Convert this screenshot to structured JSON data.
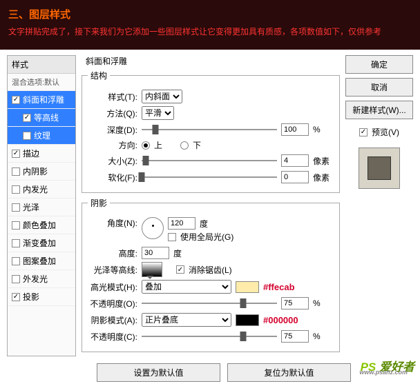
{
  "banner": {
    "title": "三、图层样式",
    "sub": "文字拼贴完成了，接下来我们为它添加一些图层样式让它变得更加具有质感，各项数值如下，仅供参考"
  },
  "sidebar": {
    "header": "样式",
    "bopts": "混合选项:默认",
    "items": [
      {
        "label": "斜面和浮雕",
        "checked": true,
        "selected": true
      },
      {
        "label": "等高线",
        "checked": true,
        "selected": true,
        "indent": true
      },
      {
        "label": "纹理",
        "checked": false,
        "selected": true,
        "indent": true
      },
      {
        "label": "描边",
        "checked": true
      },
      {
        "label": "内阴影",
        "checked": false
      },
      {
        "label": "内发光",
        "checked": false
      },
      {
        "label": "光泽",
        "checked": false
      },
      {
        "label": "颜色叠加",
        "checked": false
      },
      {
        "label": "渐变叠加",
        "checked": false
      },
      {
        "label": "图案叠加",
        "checked": false
      },
      {
        "label": "外发光",
        "checked": false
      },
      {
        "label": "投影",
        "checked": true
      }
    ]
  },
  "panel": {
    "title": "斜面和浮雕",
    "struct": {
      "legend": "结构",
      "style_lbl": "样式(T):",
      "style_val": "内斜面",
      "tech_lbl": "方法(Q):",
      "tech_val": "平滑",
      "depth_lbl": "深度(D):",
      "depth_val": "100",
      "depth_unit": "%",
      "dir_lbl": "方向:",
      "dir_up": "上",
      "dir_down": "下",
      "size_lbl": "大小(Z):",
      "size_val": "4",
      "size_unit": "像素",
      "soft_lbl": "软化(F):",
      "soft_val": "0",
      "soft_unit": "像素"
    },
    "shading": {
      "legend": "阴影",
      "angle_lbl": "角度(N):",
      "angle_val": "120",
      "angle_unit": "度",
      "global_lbl": "使用全局光(G)",
      "alt_lbl": "高度:",
      "alt_val": "30",
      "alt_unit": "度",
      "gloss_lbl": "光泽等高线:",
      "aa_lbl": "消除锯齿(L)",
      "hmode_lbl": "高光模式(H):",
      "hmode_val": "叠加",
      "hhex": "#ffecab",
      "hop_lbl": "不透明度(O):",
      "hop_val": "75",
      "hop_unit": "%",
      "smode_lbl": "阴影模式(A):",
      "smode_val": "正片叠底",
      "shex": "#000000",
      "sop_lbl": "不透明度(C):",
      "sop_val": "75",
      "sop_unit": "%"
    },
    "b1": "设置为默认值",
    "b2": "复位为默认值"
  },
  "right": {
    "ok": "确定",
    "cancel": "取消",
    "new": "新建样式(W)...",
    "preview_lbl": "预览(V)"
  },
  "wm": {
    "logo1": "PS",
    "logo2": "爱好者",
    "url": "www.psahz.com"
  }
}
